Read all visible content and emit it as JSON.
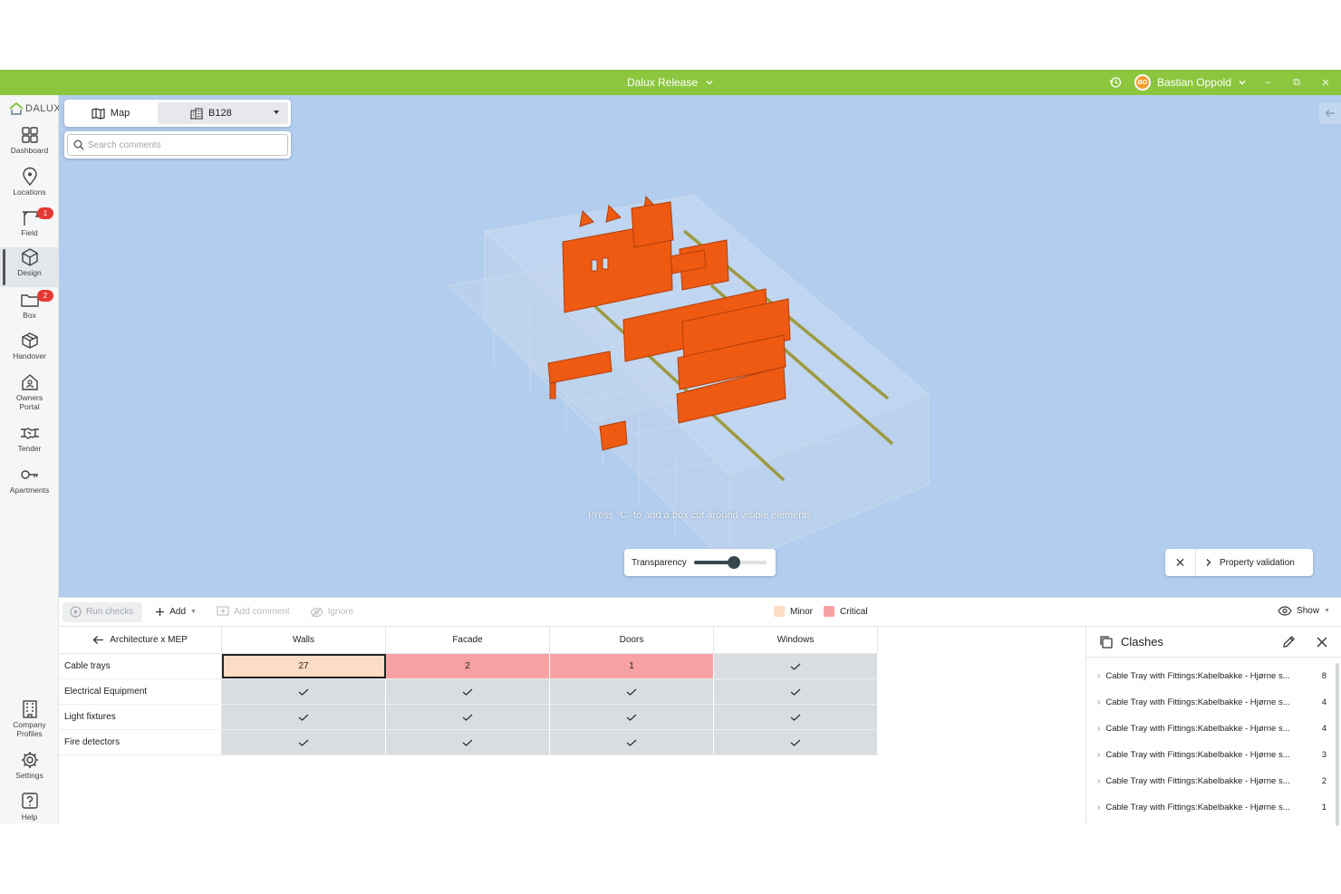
{
  "titlebar": {
    "app_title": "Dalux Release",
    "user_initials": "BO",
    "user_name": "Bastian Oppold",
    "accent_color": "#8cc63f"
  },
  "sidebar": {
    "logo_text": "DALUX",
    "items": [
      {
        "label": "Dashboard",
        "icon": "dashboard-icon"
      },
      {
        "label": "Locations",
        "icon": "location-pin-icon"
      },
      {
        "label": "Field",
        "icon": "crane-icon",
        "badge": "1"
      },
      {
        "label": "Design",
        "icon": "cube-icon",
        "active": true
      },
      {
        "label": "Box",
        "icon": "folder-icon",
        "badge": "2"
      },
      {
        "label": "Handover",
        "icon": "box-icon"
      },
      {
        "label": "Owners Portal",
        "icon": "house-icon"
      },
      {
        "label": "Tender",
        "icon": "handshake-icon"
      },
      {
        "label": "Apartments",
        "icon": "key-icon"
      }
    ],
    "bottom_items": [
      {
        "label": "Company Profiles",
        "icon": "building-icon"
      },
      {
        "label": "Settings",
        "icon": "gear-icon"
      },
      {
        "label": "Help",
        "icon": "help-icon"
      }
    ]
  },
  "viewer": {
    "map_label": "Map",
    "building_label": "B128",
    "search_placeholder": "Search comments",
    "hint": "Press \"C\" to add a box cut around visible elements",
    "transparency_label": "Transparency",
    "transparency_value": 0.55,
    "property_validation_label": "Property validation"
  },
  "toolbar": {
    "run_checks": "Run checks",
    "add": "Add",
    "add_comment": "Add comment",
    "ignore": "Ignore",
    "legend_minor": "Minor",
    "legend_critical": "Critical",
    "minor_color": "#fddcc5",
    "critical_color": "#f7a1a3",
    "show": "Show"
  },
  "matrix": {
    "title": "Architecture x MEP",
    "columns": [
      "Walls",
      "Facade",
      "Doors",
      "Windows"
    ],
    "rows": [
      {
        "label": "Cable trays",
        "cells": [
          {
            "value": "27",
            "status": "minor"
          },
          {
            "value": "2",
            "status": "critical"
          },
          {
            "value": "1",
            "status": "critical"
          },
          {
            "value": "",
            "status": "ok"
          }
        ]
      },
      {
        "label": "Electrical Equipment",
        "cells": [
          {
            "value": "",
            "status": "ok"
          },
          {
            "value": "",
            "status": "ok"
          },
          {
            "value": "",
            "status": "ok"
          },
          {
            "value": "",
            "status": "ok"
          }
        ]
      },
      {
        "label": "Light fixtures",
        "cells": [
          {
            "value": "",
            "status": "ok"
          },
          {
            "value": "",
            "status": "ok"
          },
          {
            "value": "",
            "status": "ok"
          },
          {
            "value": "",
            "status": "ok"
          }
        ]
      },
      {
        "label": "Fire detectors",
        "cells": [
          {
            "value": "",
            "status": "ok"
          },
          {
            "value": "",
            "status": "ok"
          },
          {
            "value": "",
            "status": "ok"
          },
          {
            "value": "",
            "status": "ok"
          }
        ]
      }
    ]
  },
  "clashes": {
    "title": "Clashes",
    "items": [
      {
        "label": "Cable Tray with Fittings:Kabelbakke - Hjørne s...",
        "count": "8"
      },
      {
        "label": "Cable Tray with Fittings:Kabelbakke - Hjørne s...",
        "count": "4"
      },
      {
        "label": "Cable Tray with Fittings:Kabelbakke - Hjørne s...",
        "count": "4"
      },
      {
        "label": "Cable Tray with Fittings:Kabelbakke - Hjørne s...",
        "count": "3"
      },
      {
        "label": "Cable Tray with Fittings:Kabelbakke - Hjørne s...",
        "count": "2"
      },
      {
        "label": "Cable Tray with Fittings:Kabelbakke - Hjørne s...",
        "count": "1"
      }
    ]
  }
}
